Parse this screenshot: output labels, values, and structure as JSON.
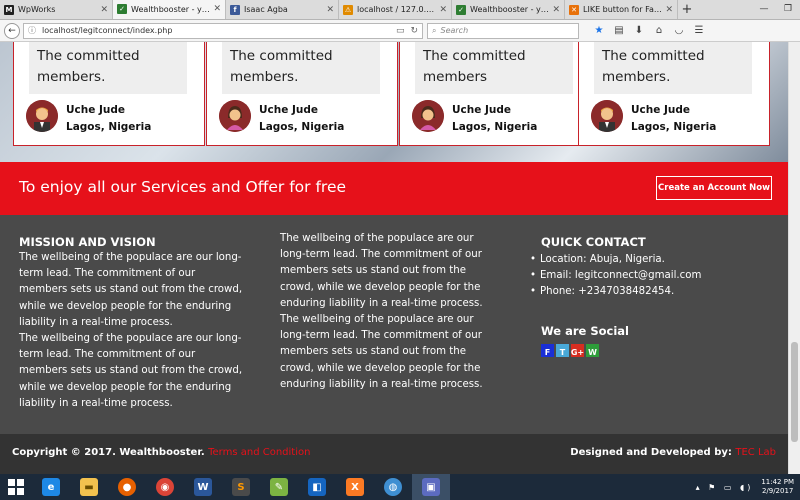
{
  "browser": {
    "tabs": [
      {
        "title": "WpWorks",
        "icon": "M",
        "icon_color": "#222222"
      },
      {
        "title": "Wealthbooster - you...",
        "icon": "✓",
        "icon_color": "#2e7d32",
        "active": true
      },
      {
        "title": "Isaac Agba",
        "icon": "f",
        "icon_color": "#3b5998"
      },
      {
        "title": "localhost / 127.0.0.1 ...",
        "icon": "⚠",
        "icon_color": "#e08a00"
      },
      {
        "title": "Wealthbooster - you...",
        "icon": "✓",
        "icon_color": "#2e7d32"
      },
      {
        "title": "LIKE button for Fashi...",
        "icon": "✕",
        "icon_color": "#e8710a"
      }
    ],
    "new_tab_label": "+",
    "url": "localhost/legitconnect/index.php",
    "search_placeholder": "Search"
  },
  "testimonials": [
    {
      "quote": "The committed members.",
      "name": "Uche Jude",
      "location": "Lagos, Nigeria",
      "avatar": "male"
    },
    {
      "quote": "The committed members.",
      "name": "Uche Jude",
      "location": "Lagos, Nigeria",
      "avatar": "female"
    },
    {
      "quote": "The committed members",
      "name": "Uche Jude",
      "location": "Lagos, Nigeria",
      "avatar": "female"
    },
    {
      "quote": "The committed members.",
      "name": "Uche Jude",
      "location": "Lagos, Nigeria",
      "avatar": "male"
    }
  ],
  "cta": {
    "text": "To enjoy all our Services and Offer for free",
    "button_label": "Create an Account Now"
  },
  "footer": {
    "mission_heading": "MISSION AND VISION",
    "mission_text_1": "The wellbeing of the populace are our long-term lead. The commitment of our members sets us stand out from the crowd, while we develop people for the enduring liability in a real-time process.",
    "mission_text_2": "The wellbeing of the populace are our long-term lead. The commitment of our members sets us stand out from the crowd, while we develop people for the enduring liability in a real-time process.",
    "middle_text_1": "The wellbeing of the populace are our long-term lead. The commitment of our members sets us stand out from the crowd, while we develop people for the enduring liability in a real-time process.",
    "middle_text_2": "The wellbeing of the populace are our long-term lead. The commitment of our members sets us stand out from the crowd, while we develop people for the enduring liability in a real-time process.",
    "contact_heading": "QUICK CONTACT",
    "contact_location": "Location: Abuja, Nigeria.",
    "contact_email": "Email: legitconnect@gmail.com",
    "contact_phone": "Phone: +2347038482454.",
    "social_heading": "We are Social",
    "social": [
      {
        "label": "F",
        "color": "#1a2fd6"
      },
      {
        "label": "T",
        "color": "#49a9d8"
      },
      {
        "label": "G+",
        "color": "#d62d20"
      },
      {
        "label": "W",
        "color": "#2e9d3a"
      }
    ]
  },
  "bottom": {
    "copyright": "Copyright © 2017. Wealthbooster.",
    "terms_link": "Terms and Condition",
    "designed_by": "Designed and Developed by:",
    "designer_link": "TEC Lab"
  },
  "taskbar": {
    "time": "11:42 PM",
    "date": "2/9/2017"
  }
}
